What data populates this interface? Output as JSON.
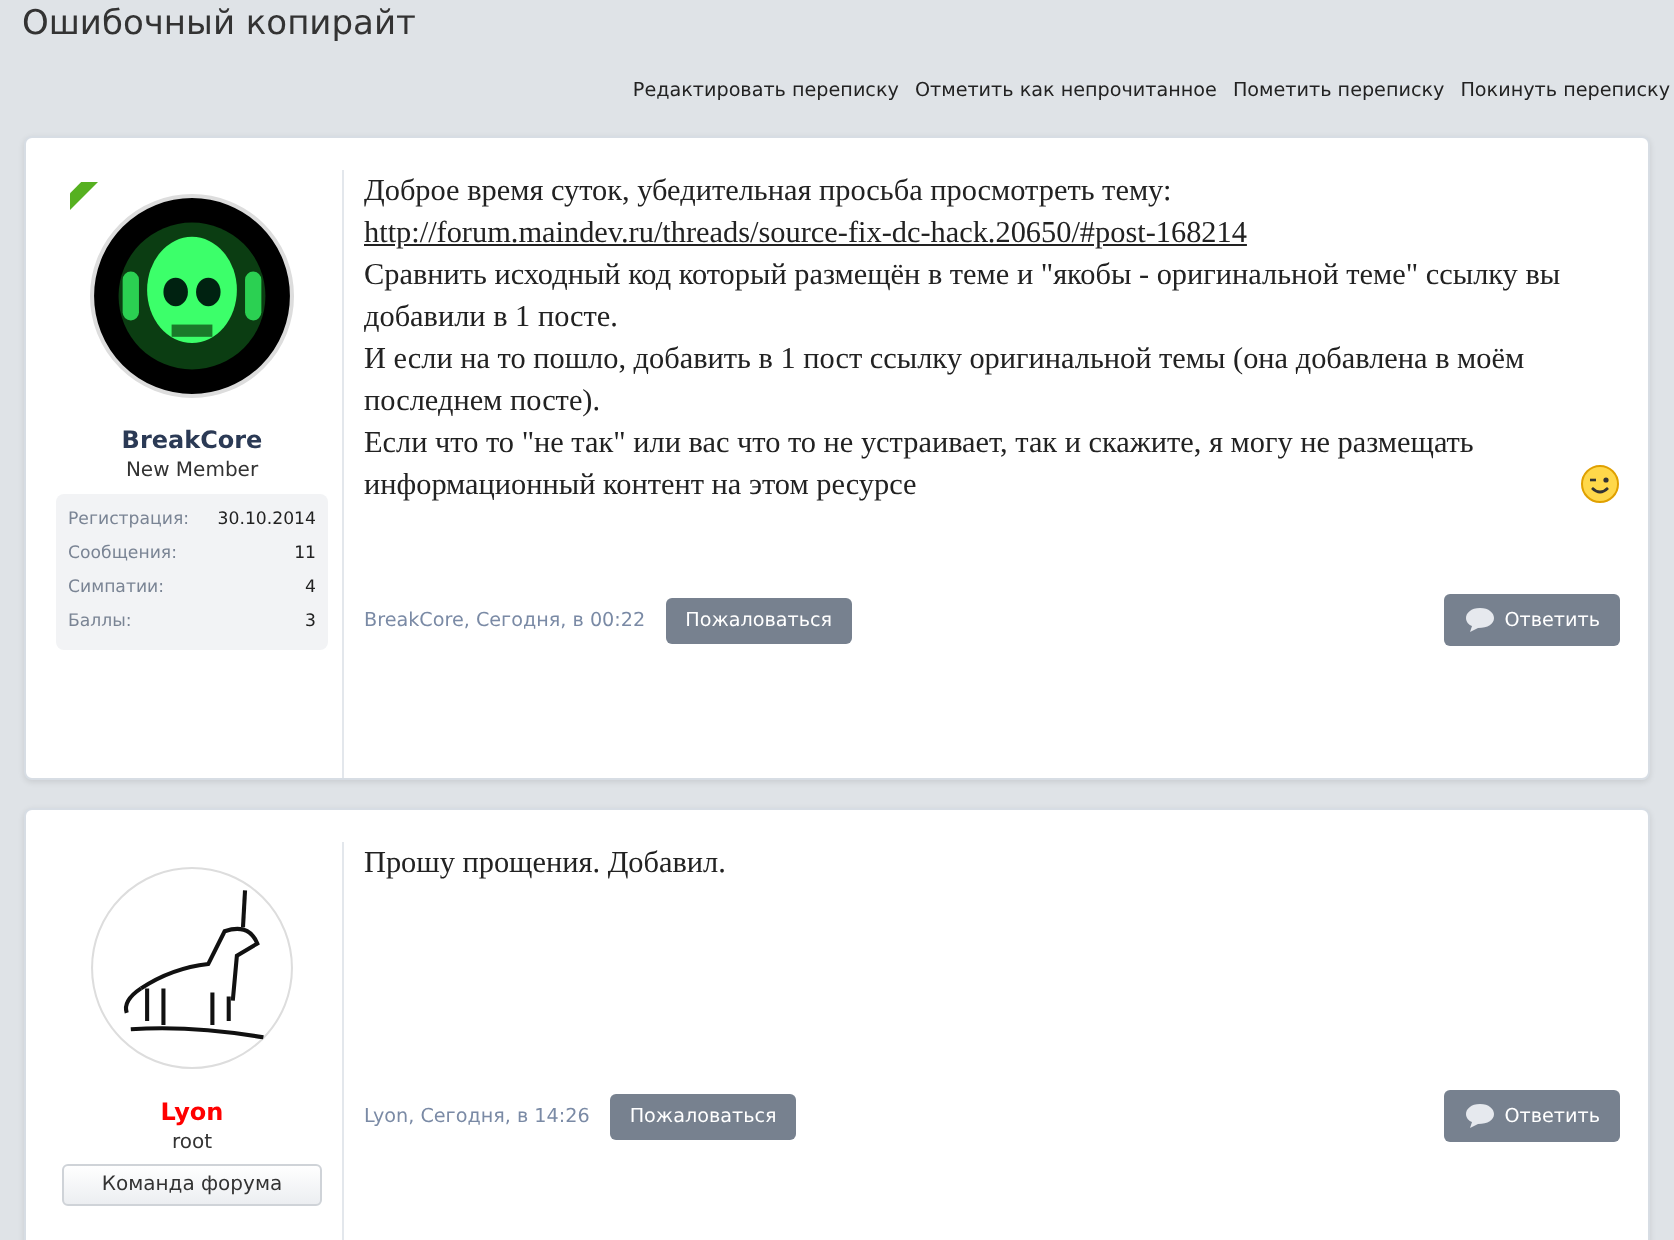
{
  "title": "Ошибочный копирайт",
  "actions": [
    "Редактировать переписку",
    "Отметить как непрочитанное",
    "Пометить переписку",
    "Покинуть переписку"
  ],
  "posts": [
    {
      "new": true,
      "user": {
        "name": "BreakCore",
        "kind": "member",
        "title": "New Member",
        "stats": [
          {
            "label": "Регистрация:",
            "value": "30.10.2014"
          },
          {
            "label": "Сообщения:",
            "value": "11"
          },
          {
            "label": "Симпатии:",
            "value": "4"
          },
          {
            "label": "Баллы:",
            "value": "3"
          }
        ]
      },
      "paragraphs": [
        {
          "kind": "text",
          "text": "Доброе время суток, убедительная просьба просмотреть тему:"
        },
        {
          "kind": "link",
          "text": "http://forum.maindev.ru/threads/source-fix-dc-hack.20650/#post-168214"
        },
        {
          "kind": "text",
          "text": "Сравнить исходный код который размещён в теме и \"якобы - оригинальной теме\" ссылку вы добавили в 1 посте."
        },
        {
          "kind": "text",
          "text": "И если на то пошло, добавить в 1 пост ссылку оригинальной темы (она добавлена в моём последнем посте)."
        },
        {
          "kind": "smile",
          "text": "Если что то \"не так\" или вас что то не устраивает, так и скажите, я могу не размещать информационный контент на этом ресурсе"
        }
      ],
      "meta": "BreakCore, Сегодня, в 00:22",
      "report": "Пожаловаться",
      "reply": "Ответить"
    },
    {
      "new": false,
      "user": {
        "name": "Lyon",
        "kind": "staff",
        "title": "root",
        "banner": "Команда форума"
      },
      "paragraphs": [
        {
          "kind": "text",
          "text": "Прошу прощения. Добавил."
        }
      ],
      "meta": "Lyon, Сегодня, в 14:26",
      "report": "Пожаловаться",
      "reply": "Ответить"
    }
  ]
}
